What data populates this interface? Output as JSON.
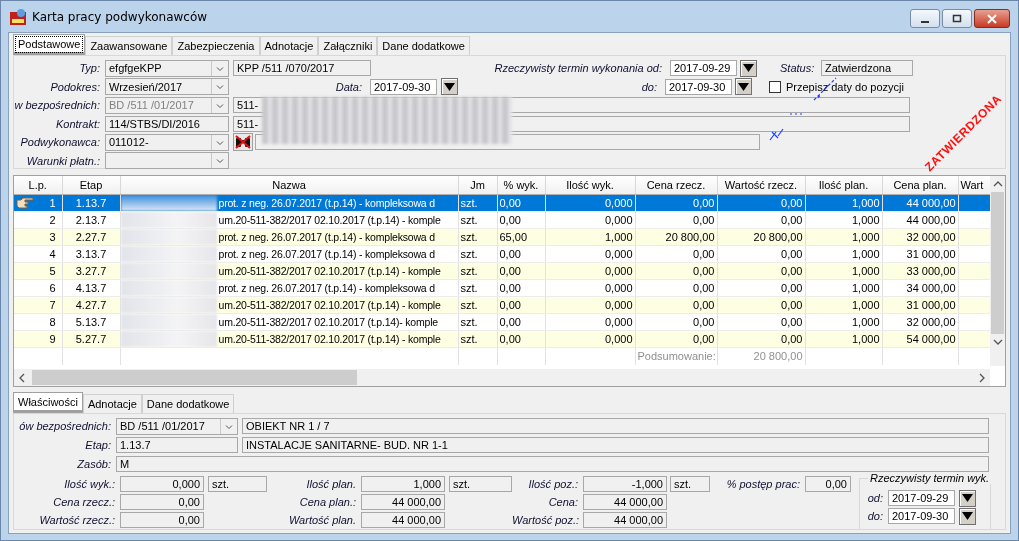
{
  "window": {
    "title": "Karta pracy podwykonawców"
  },
  "tabs": [
    {
      "label": "Podstawowe",
      "selected": true
    },
    {
      "label": "Zaawansowane",
      "selected": false
    },
    {
      "label": "Zabezpieczenia",
      "selected": false
    },
    {
      "label": "Adnotacje",
      "selected": false
    },
    {
      "label": "Załączniki",
      "selected": false
    },
    {
      "label": "Dane dodatkowe",
      "selected": false
    }
  ],
  "form": {
    "typ": {
      "label": "Typ:",
      "value": "efgfgeKPP",
      "extra": "KPP /511 /070/2017"
    },
    "podokres": {
      "label": "Podokres:",
      "value": "Wrzesień/2017"
    },
    "data": {
      "label": "Data:",
      "value": "2017-09-30"
    },
    "obiekt": {
      "label": "w bezpośrednich:",
      "value": "BD  /511 /01/2017",
      "extra": "511-",
      "disabled": true
    },
    "kontrakt": {
      "label": "Kontrakt:",
      "value": "114/STBS/DI/2016",
      "extra": "511-"
    },
    "podwykonawca": {
      "label": "Podwykonawca:",
      "value": "011012-"
    },
    "warunki": {
      "label": "Warunki płatn.:"
    },
    "termin_od": {
      "label": "Rzeczywisty termin wykonania od:",
      "value": "2017-09-29"
    },
    "termin_do": {
      "label": "do:",
      "value": "2017-09-30"
    },
    "status": {
      "label": "Status:",
      "value": "Zatwierdzona"
    },
    "przepisz": {
      "label": "Przepisz daty do pozycji",
      "checked": false
    },
    "stamp": "ZATWIERDZONA"
  },
  "table": {
    "columns": [
      "L.p.",
      "Etap",
      "Nazwa",
      "Jm",
      "% wyk.",
      "Ilość wyk.",
      "Cena rzecz.",
      "Wartość rzecz.",
      "Ilość plan.",
      "Cena plan.",
      "Wart"
    ],
    "rows": [
      {
        "selected": true,
        "cells": [
          "1",
          "1.13.7",
          "prot. z neg. 26.07.2017 (t.p.14) - kompleksowa d",
          "szt.",
          "0,00",
          "0,000",
          "0,00",
          "0,00",
          "1,000",
          "44 000,00"
        ]
      },
      {
        "selected": false,
        "cells": [
          "2",
          "2.13.7",
          "um.20-511-382/2017  02.10.2017 (t.p.14) - komple",
          "szt.",
          "0,00",
          "0,000",
          "0,00",
          "0,00",
          "1,000",
          "44 000,00"
        ]
      },
      {
        "selected": false,
        "cells": [
          "3",
          "2.27.7",
          "prot. z neg. 26.07.2017 (t.p.14) - kompleksowa d",
          "szt.",
          "65,00",
          "1,000",
          "20 800,00",
          "20 800,00",
          "1,000",
          "32 000,00"
        ]
      },
      {
        "selected": false,
        "cells": [
          "4",
          "3.13.7",
          "prot. z neg. 26.07.2017 (t.p.14) - kompleksowa d",
          "szt.",
          "0,00",
          "0,000",
          "0,00",
          "0,00",
          "1,000",
          "31 000,00"
        ]
      },
      {
        "selected": false,
        "cells": [
          "5",
          "3.27.7",
          "um.20-511-382/2017  02.10.2017 (t.p.14) - komple",
          "szt.",
          "0,00",
          "0,000",
          "0,00",
          "0,00",
          "1,000",
          "33 000,00"
        ]
      },
      {
        "selected": false,
        "cells": [
          "6",
          "4.13.7",
          "prot. z neg. 26.07.2017 (t.p.14) - kompleksowa d",
          "szt.",
          "0,00",
          "0,000",
          "0,00",
          "0,00",
          "1,000",
          "34 000,00"
        ]
      },
      {
        "selected": false,
        "cells": [
          "7",
          "4.27.7",
          "um.20-511-382/2017  02.10.2017 (t.p.14) - komple",
          "szt.",
          "0,00",
          "0,000",
          "0,00",
          "0,00",
          "1,000",
          "31 000,00"
        ]
      },
      {
        "selected": false,
        "cells": [
          "8",
          "5.13.7",
          "um.20-511-382/2017  02.10.2017 (t.p.14)- komple",
          "szt.",
          "0,00",
          "0,000",
          "0,00",
          "0,00",
          "1,000",
          "32 000,00"
        ]
      },
      {
        "selected": false,
        "cells": [
          "9",
          "5.27.7",
          "um.20-511-382/2017  02.10.2017 (t.p.14) - komple",
          "szt.",
          "0,00",
          "0,000",
          "0,00",
          "0,00",
          "1,000",
          "54 000,00"
        ]
      }
    ],
    "summary": {
      "label": "Podsumowanie:",
      "value": "20 800,00"
    }
  },
  "bottom_tabs": [
    {
      "label": "Właściwości",
      "selected": true
    },
    {
      "label": "Adnotacje",
      "selected": false
    },
    {
      "label": "Dane dodatkowe",
      "selected": false
    }
  ],
  "details": {
    "obiekt": {
      "label": "ów bezpośrednich:",
      "value": "BD  /511 /01/2017",
      "extra": "OBIEKT NR 1 / 7"
    },
    "etap": {
      "label": "Etap:",
      "value": "1.13.7",
      "extra": "INSTALACJE SANITARNE- BUD. NR 1-1"
    },
    "zasob": {
      "label": "Zasób:",
      "value": "M"
    },
    "metrics": [
      [
        {
          "label": "Ilość wyk.:",
          "value": "0,000",
          "unit": "szt."
        },
        {
          "label": "Cena rzecz.:",
          "value": "0,00"
        },
        {
          "label": "Wartość rzecz.:",
          "value": "0,00"
        }
      ],
      [
        {
          "label": "Ilość plan.",
          "value": "1,000",
          "unit": "szt."
        },
        {
          "label": "Cena plan.:",
          "value": "44 000,00"
        },
        {
          "label": "Wartość plan.",
          "value": "44 000,00"
        }
      ],
      [
        {
          "label": "Ilość poz.:",
          "value": "-1,000",
          "unit": "szt."
        },
        {
          "label": "Cena:",
          "value": "44 000,00"
        },
        {
          "label": "Wartość poz.:",
          "value": "44 000,00"
        }
      ]
    ],
    "postep": {
      "label": "% postęp prac:",
      "value": "0,00"
    },
    "termin": {
      "title": "Rzeczywisty termin wyk.",
      "od": {
        "label": "od:",
        "value": "2017-09-29"
      },
      "do": {
        "label": "do:",
        "value": "2017-09-30"
      }
    }
  }
}
